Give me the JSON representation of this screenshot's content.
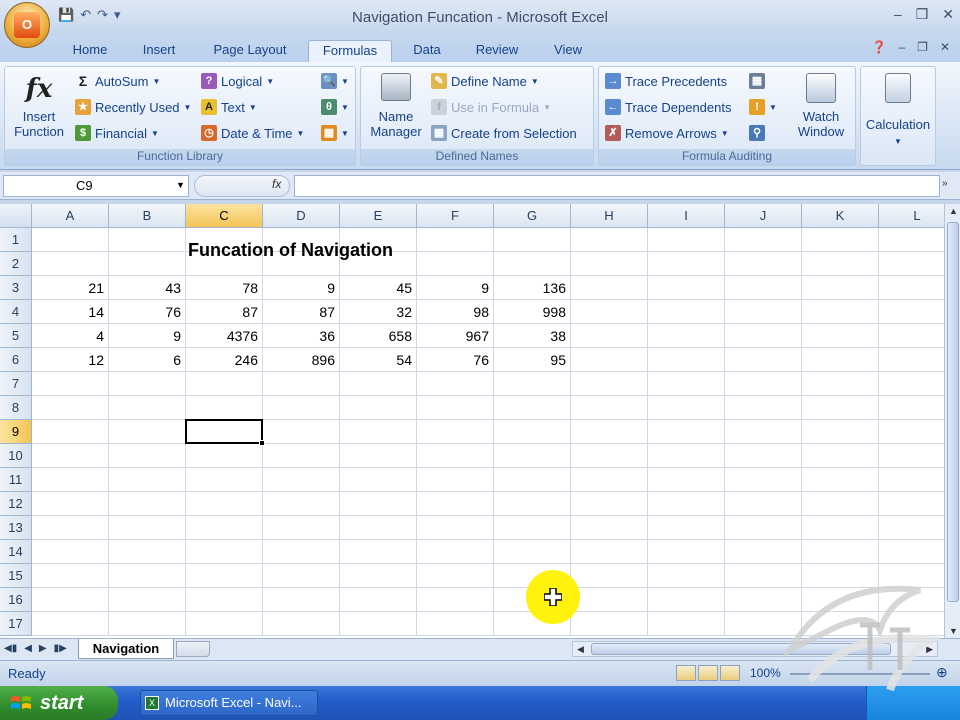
{
  "window": {
    "title": "Navigation Funcation - Microsoft Excel"
  },
  "tabs": [
    {
      "label": "Home"
    },
    {
      "label": "Insert"
    },
    {
      "label": "Page Layout"
    },
    {
      "label": "Formulas"
    },
    {
      "label": "Data"
    },
    {
      "label": "Review"
    },
    {
      "label": "View"
    }
  ],
  "ribbon": {
    "function_library": {
      "label": "Function Library",
      "insert_function_line1": "Insert",
      "insert_function_line2": "Function",
      "autosum": "AutoSum",
      "recently_used": "Recently Used",
      "financial": "Financial",
      "logical": "Logical",
      "text": "Text",
      "date_time": "Date & Time"
    },
    "defined_names": {
      "label": "Defined Names",
      "name_manager_line1": "Name",
      "name_manager_line2": "Manager",
      "define_name": "Define Name",
      "use_in_formula": "Use in Formula",
      "create_from_selection": "Create from Selection"
    },
    "formula_auditing": {
      "label": "Formula Auditing",
      "trace_precedents": "Trace Precedents",
      "trace_dependents": "Trace Dependents",
      "remove_arrows": "Remove Arrows",
      "watch_window_line1": "Watch",
      "watch_window_line2": "Window"
    },
    "calculation": {
      "label": "Calculation"
    }
  },
  "formula_bar": {
    "name_box": "C9",
    "fx": "fx",
    "formula": ""
  },
  "grid": {
    "columns": [
      "A",
      "B",
      "C",
      "D",
      "E",
      "F",
      "G",
      "H",
      "I",
      "J",
      "K",
      "L"
    ],
    "rows": [
      "1",
      "2",
      "3",
      "4",
      "5",
      "6",
      "7",
      "8",
      "9",
      "10",
      "11",
      "12",
      "13",
      "14",
      "15",
      "16",
      "17"
    ],
    "selected_column": "C",
    "selected_row": "9",
    "title": "Funcation of Navigation",
    "data": [
      [
        "21",
        "43",
        "78",
        "9",
        "45",
        "9",
        "136"
      ],
      [
        "14",
        "76",
        "87",
        "87",
        "32",
        "98",
        "998"
      ],
      [
        "4",
        "9",
        "4376",
        "36",
        "658",
        "967",
        "38"
      ],
      [
        "12",
        "6",
        "246",
        "896",
        "54",
        "76",
        "95"
      ]
    ]
  },
  "sheet_tabs": [
    {
      "label": "Navigation"
    }
  ],
  "status": {
    "text": "Ready",
    "zoom": "100%"
  },
  "taskbar": {
    "start": "start",
    "item": "Microsoft Excel - Navi..."
  }
}
